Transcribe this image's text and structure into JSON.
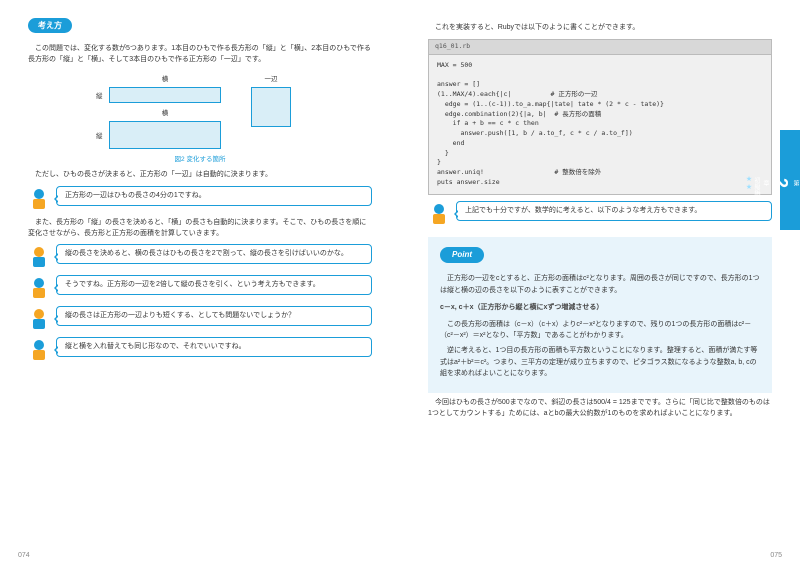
{
  "left": {
    "pageNum": "074",
    "heading": "考え方",
    "para1": "この問題では、変化する数が5つあります。1本目のひもで作る長方形の「縦」と「横」、2本目のひもで作る長方形の「縦」と「横」、そして3本目のひもで作る正方形の「一辺」です。",
    "diag": {
      "yoko": "横",
      "tate": "縦",
      "ippen": "一辺"
    },
    "caption": "図2 変化する箇所",
    "para2": "ただし、ひもの長さが決まると、正方形の「一辺」は自動的に決まります。",
    "d1": "正方形の一辺はひもの長さの4分の1ですね。",
    "para3": "また、長方形の「縦」の長さを決めると、「横」の長さも自動的に決まります。そこで、ひもの長さを順に変化させながら、長方形と正方形の面積を計算していきます。",
    "d2": "縦の長さを決めると、横の長さはひもの長さを2で割って、縦の長さを引けばいいのかな。",
    "d3": "そうですね。正方形の一辺を2倍して縦の長さを引く、という考え方もできます。",
    "d4": "縦の長さは正方形の一辺よりも短くする、としても問題ないでしょうか？",
    "d5": "縦と横を入れ替えても同じ形なので、それでいいですね。"
  },
  "right": {
    "pageNum": "075",
    "intro": "これを実装すると、Rubyでは以下のように書くことができます。",
    "codeTitle": "q16_01.rb",
    "code": "MAX = 500\n\nanswer = []\n(1..MAX/4).each{|c|          # 正方形の一辺\n  edge = (1..(c-1)).to_a.map{|tate| tate * (2 * c - tate)}\n  edge.combination(2){|a, b|  # 長方形の面積\n    if a + b == c * c then\n      answer.push([1, b / a.to_f, c * c / a.to_f])\n    end\n  }\n}\nanswer.uniq!                  # 整数倍を除外\nputs answer.size",
    "d1": "上記でも十分ですが、数学的に考えると、以下のような考え方もできます。",
    "point": {
      "label": "Point",
      "p1": "正方形の一辺をcとすると、正方形の面積はc²となります。周囲の長さが同じですので、長方形の1つは縦と横の辺の長さを以下のように表すことができます。",
      "strong": "c－x, c＋x（正方形から縦と横にxずつ増減させる）",
      "p2": "この長方形の面積は（c－x）（c＋x）よりc²－x²となりますので、残りの1つの長方形の面積はc²－（c²－x²）＝x²となり、「平方数」であることがわかります。",
      "p3": "逆に考えると、1つ目の長方形の面積も平方数ということになります。整理すると、面積が満たす等式はa²＋b²＝c²。つまり、三平方の定理が成り立ちますので、ピタゴラス数になるような整数a, b, cの組を求めればよいことになります。"
    },
    "outroP1": "今回はひもの長さが500までなので、斜辺の長さは500/4 = 125までです。さらに「同じ比で整数倍のものは1つとしてカウントする」ためには、aとbの最大公約数が1のものを求めればよいことになります。"
  },
  "sidetab": {
    "label1": "第",
    "num": "2",
    "label2": "章",
    "sub": "初級編",
    "stars": "★★"
  }
}
